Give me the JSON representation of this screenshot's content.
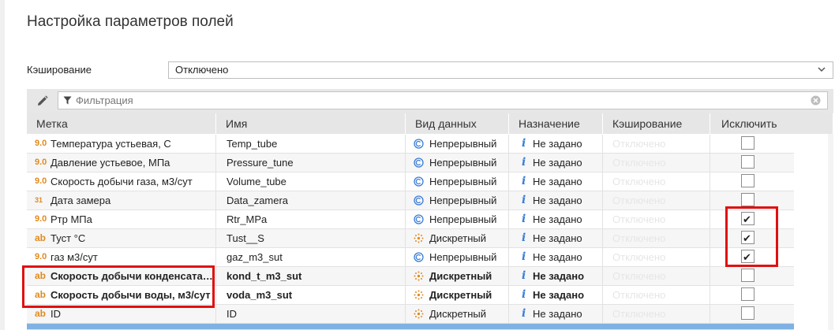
{
  "title": "Настройка параметров полей",
  "caching": {
    "label": "Кэширование",
    "value": "Отключено"
  },
  "filter": {
    "placeholder": "Фильтрация"
  },
  "columns": [
    "Метка",
    "Имя",
    "Вид данных",
    "Назначение",
    "Кэширование",
    "Исключить"
  ],
  "rows": [
    {
      "type": "9.0",
      "label": "Температура устьевая, С",
      "name": "Temp_tube",
      "dtype": "Непрерывный",
      "dtype_icon": "continuous-icon",
      "dest": "Не задано",
      "cache": "Отключено",
      "excluded": false,
      "bold": false
    },
    {
      "type": "9.0",
      "label": "Давление устьевое, МПа",
      "name": "Pressure_tune",
      "dtype": "Непрерывный",
      "dtype_icon": "continuous-icon",
      "dest": "Не задано",
      "cache": "Отключено",
      "excluded": false,
      "bold": false
    },
    {
      "type": "9.0",
      "label": "Скорость добычи газа, м3/сут",
      "name": "Volume_tube",
      "dtype": "Непрерывный",
      "dtype_icon": "continuous-icon",
      "dest": "Не задано",
      "cache": "Отключено",
      "excluded": false,
      "bold": false
    },
    {
      "type": "31",
      "label": "Дата замера",
      "name": "Data_zamera",
      "dtype": "Непрерывный",
      "dtype_icon": "continuous-icon",
      "dest": "Не задано",
      "cache": "Отключено",
      "excluded": false,
      "bold": false
    },
    {
      "type": "9.0",
      "label": "Ртр МПа",
      "name": "Rtr_MPa",
      "dtype": "Непрерывный",
      "dtype_icon": "continuous-icon",
      "dest": "Не задано",
      "cache": "Отключено",
      "excluded": true,
      "bold": false
    },
    {
      "type": "ab",
      "label": "Туст °С",
      "name": "Tust__S",
      "dtype": "Дискретный",
      "dtype_icon": "discrete-icon",
      "dest": "Не задано",
      "cache": "Отключено",
      "excluded": true,
      "bold": false
    },
    {
      "type": "9.0",
      "label": "газ м3/сут",
      "name": "gaz_m3_sut",
      "dtype": "Непрерывный",
      "dtype_icon": "continuous-icon",
      "dest": "Не задано",
      "cache": "Отключено",
      "excluded": true,
      "bold": false
    },
    {
      "type": "ab",
      "label": "Скорость добычи конденсата…",
      "name": "kond_t_m3_sut",
      "dtype": "Дискретный",
      "dtype_icon": "discrete-icon",
      "dest": "Не задано",
      "cache": "Отключено",
      "excluded": false,
      "bold": true
    },
    {
      "type": "ab",
      "label": "Скорость добычи воды, м3/сут",
      "name": "voda_m3_sut",
      "dtype": "Дискретный",
      "dtype_icon": "discrete-icon",
      "dest": "Не задано",
      "cache": "Отключено",
      "excluded": false,
      "bold": true
    },
    {
      "type": "ab",
      "label": "ID",
      "name": "ID",
      "dtype": "Дискретный",
      "dtype_icon": "discrete-icon",
      "dest": "Не задано",
      "cache": "Отключено",
      "excluded": false,
      "bold": false
    }
  ],
  "colors": {
    "highlight": "#e01010",
    "accent": "#3b7dd8",
    "type_icon": "#e08a1e",
    "selected_row": "#7fb2e2"
  }
}
